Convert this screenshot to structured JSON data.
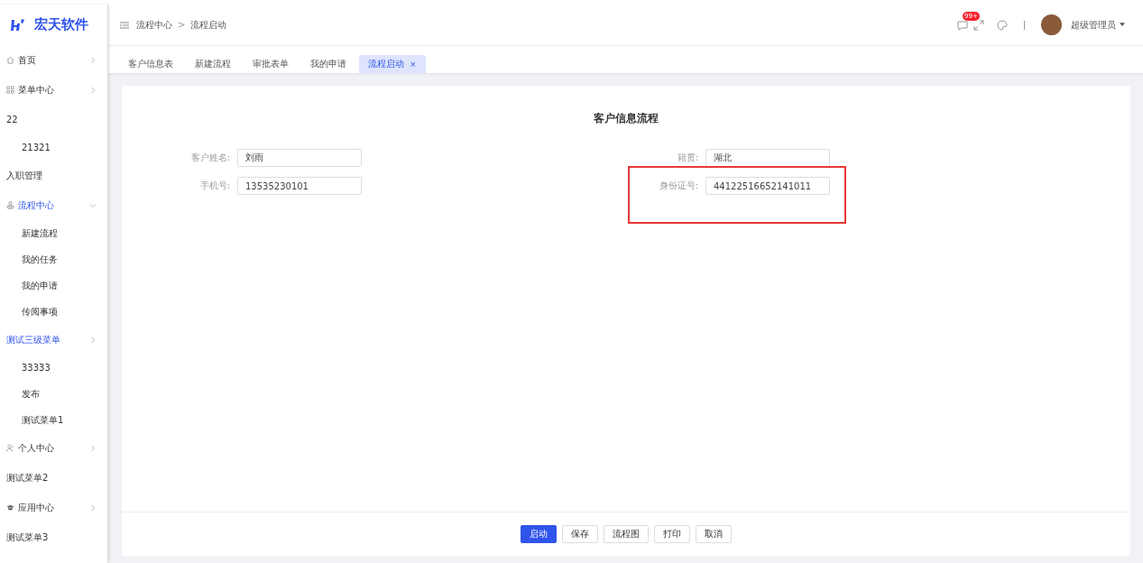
{
  "brand": {
    "name": "宏天软件"
  },
  "breadcrumb": [
    "流程中心",
    "流程启动"
  ],
  "breadcrumb_separator": ">",
  "header": {
    "badge": "99+",
    "user": "超级管理员"
  },
  "sidebar": {
    "items": [
      {
        "label": "首页",
        "kind": "home",
        "active": false,
        "expanded": false
      },
      {
        "label": "菜单中心",
        "kind": "grid",
        "active": false,
        "expanded": false
      },
      {
        "label": "22",
        "kind": "plain",
        "active": false,
        "children": [
          {
            "label": "21321"
          }
        ]
      },
      {
        "label": "入职管理",
        "kind": "plain",
        "active": false
      },
      {
        "label": "流程中心",
        "kind": "flow",
        "active": true,
        "expanded": true,
        "children": [
          {
            "label": "新建流程"
          },
          {
            "label": "我的任务"
          },
          {
            "label": "我的申请"
          },
          {
            "label": "传阅事项"
          }
        ]
      },
      {
        "label": "测试三级菜单",
        "kind": "folder",
        "active": true,
        "expanded": false,
        "children": [
          {
            "label": "33333"
          },
          {
            "label": "发布"
          },
          {
            "label": "测试菜单1"
          }
        ]
      },
      {
        "label": "个人中心",
        "kind": "user",
        "active": false,
        "expanded": false
      },
      {
        "label": "测试菜单2",
        "kind": "plain",
        "active": false
      },
      {
        "label": "应用中心",
        "kind": "app",
        "active": false,
        "expanded": false
      },
      {
        "label": "测试菜单3",
        "kind": "plain",
        "active": false
      }
    ]
  },
  "tabs": [
    {
      "label": "客户信息表",
      "selected": false
    },
    {
      "label": "新建流程",
      "selected": false
    },
    {
      "label": "审批表单",
      "selected": false
    },
    {
      "label": "我的申请",
      "selected": false
    },
    {
      "label": "流程启动",
      "selected": true,
      "close": "×"
    }
  ],
  "form": {
    "title": "客户信息流程",
    "fields": [
      {
        "label": "客户姓名:",
        "value": "刘雨",
        "highlighted": false
      },
      {
        "label": "籍贯:",
        "value": "湖北",
        "highlighted": false
      },
      {
        "label": "手机号:",
        "value": "13535230101",
        "highlighted": false
      },
      {
        "label": "身份证号:",
        "value": "44122516652141011",
        "highlighted": true
      }
    ]
  },
  "buttons": [
    {
      "label": "启动",
      "primary": true
    },
    {
      "label": "保存",
      "primary": false
    },
    {
      "label": "流程图",
      "primary": false
    },
    {
      "label": "打印",
      "primary": false
    },
    {
      "label": "取消",
      "primary": false
    }
  ]
}
